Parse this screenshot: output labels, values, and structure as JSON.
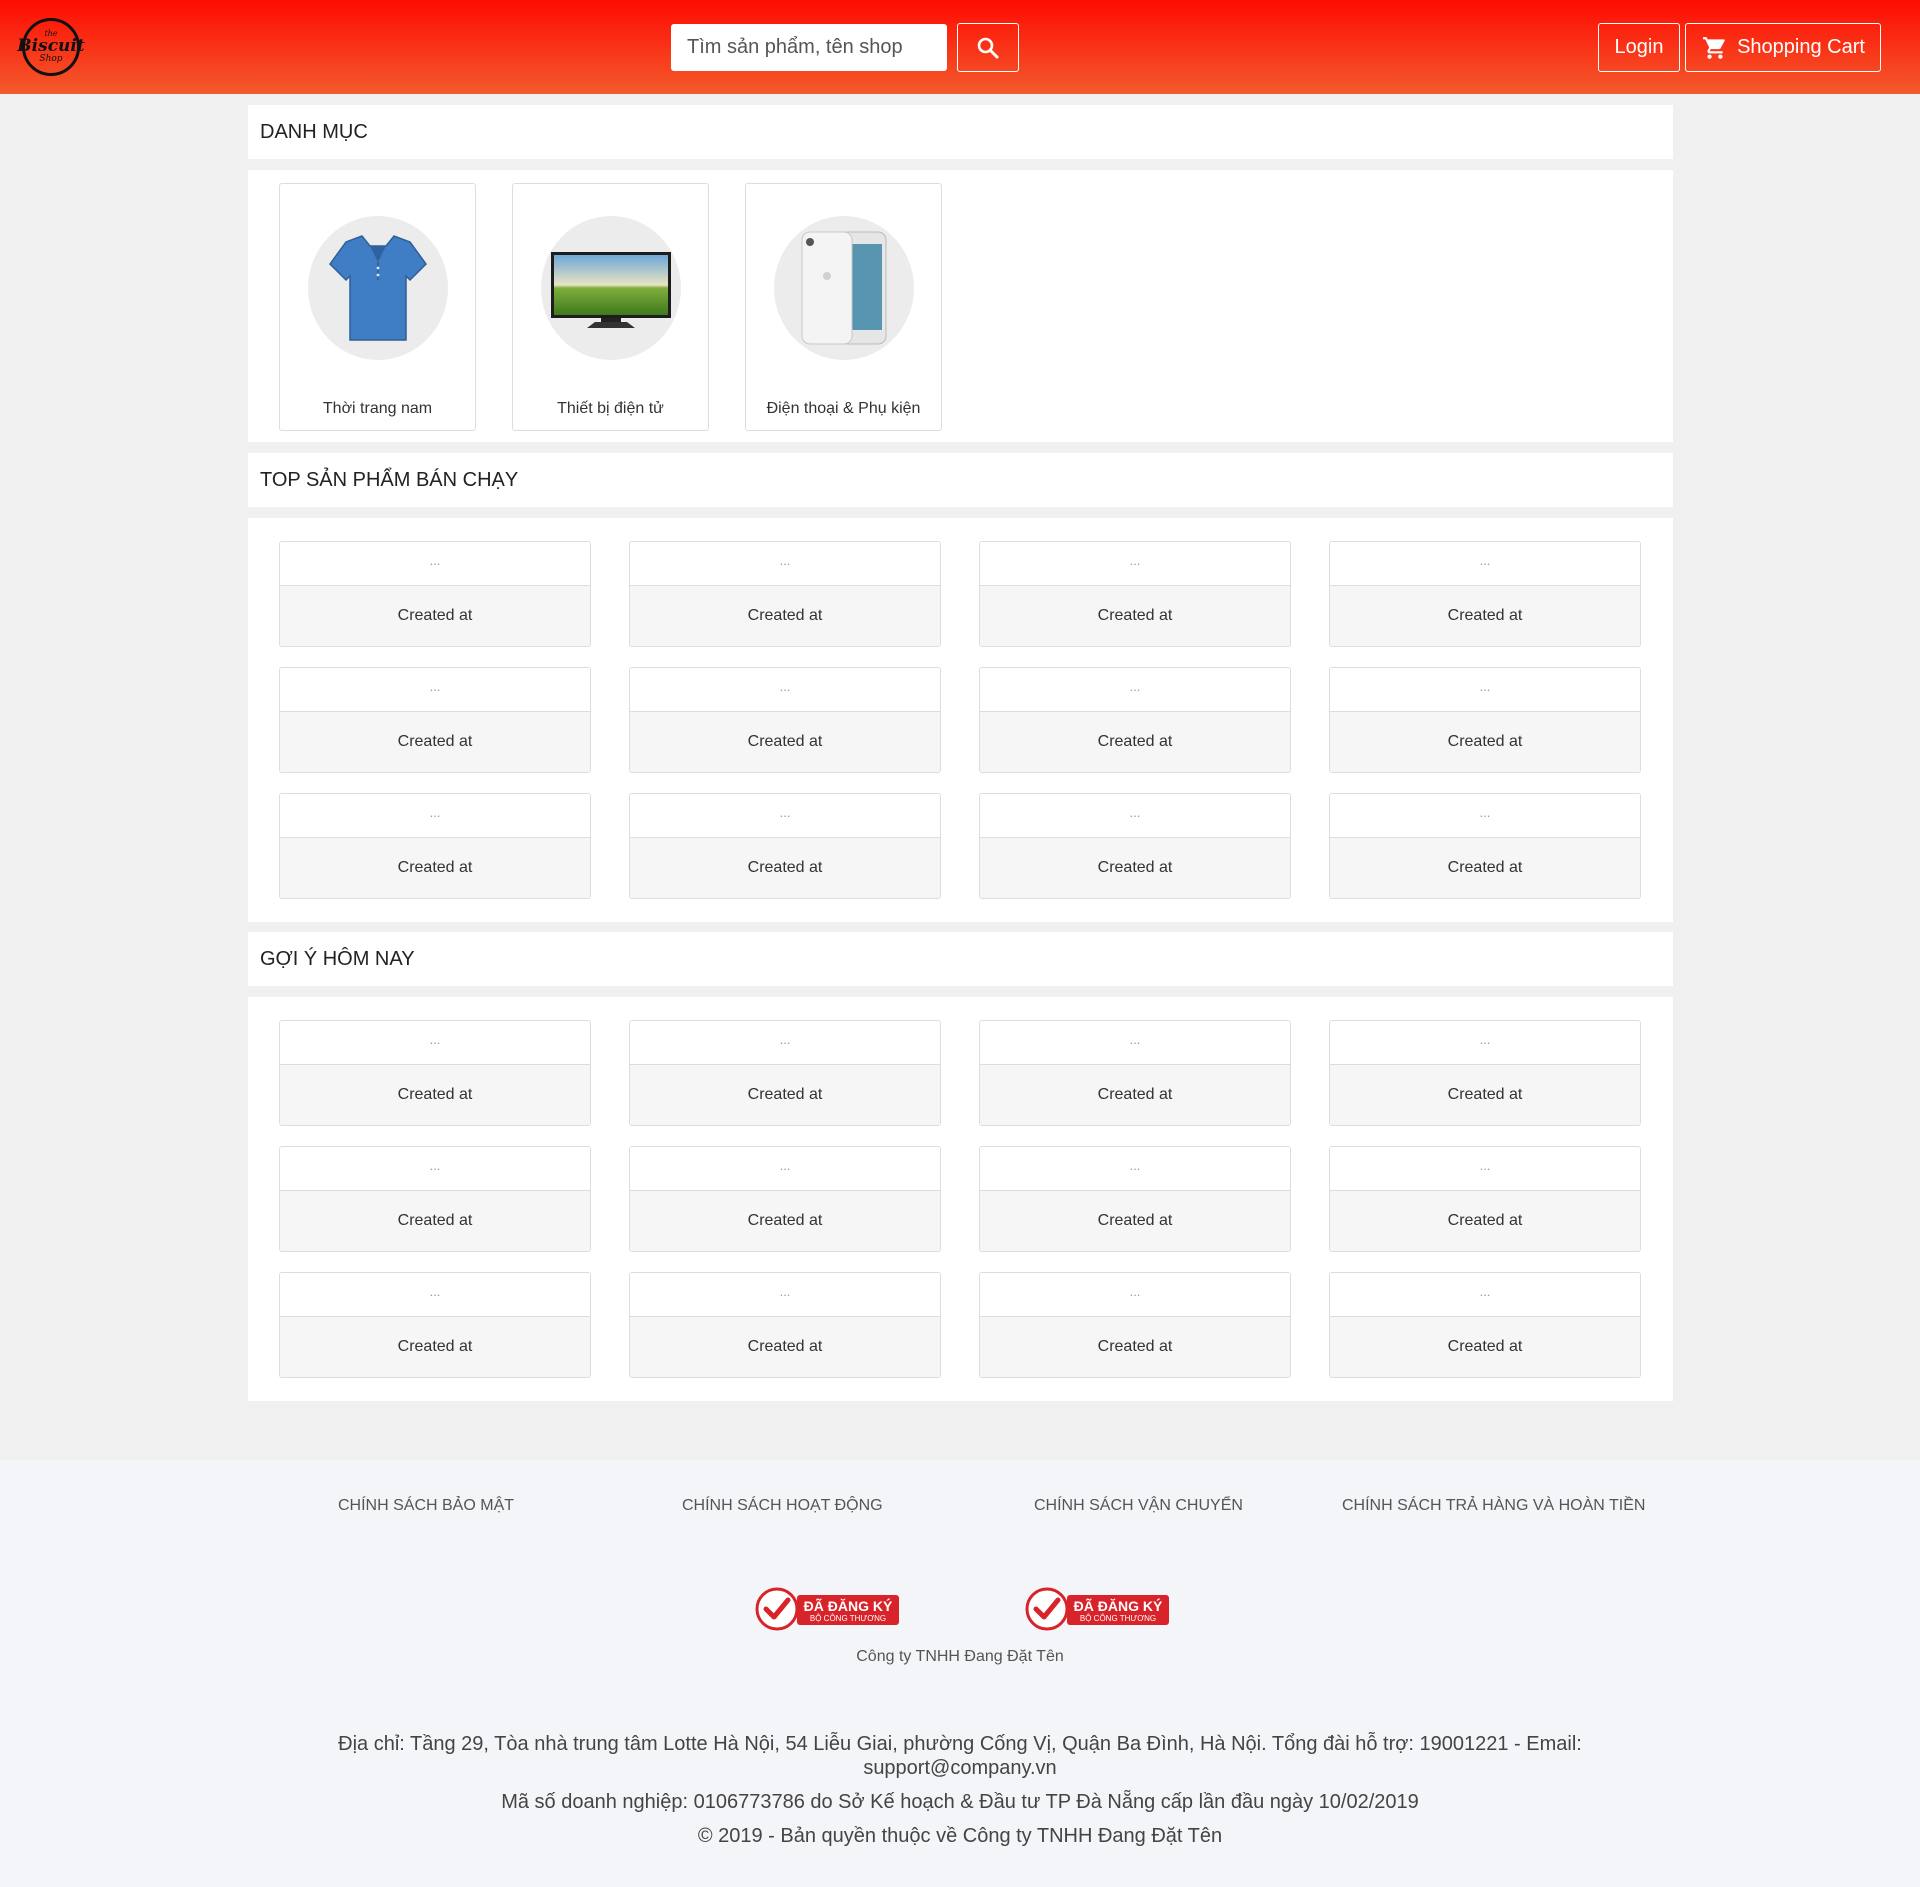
{
  "header": {
    "logo": {
      "line_top": "the",
      "line_main": "Biscuit",
      "line_bottom": "Shop"
    },
    "search_placeholder": "Tìm sản phẩm, tên shop",
    "login_label": "Login",
    "cart_label": "Shopping Cart",
    "colors": {
      "gradient_top": "#ff0b02",
      "gradient_bottom": "#f35a2c"
    }
  },
  "categories": {
    "title": "DANH MỤC",
    "items": [
      {
        "label": "Thời trang nam",
        "icon": "polo-shirt-image"
      },
      {
        "label": "Thiết bị điện tử",
        "icon": "tv-image"
      },
      {
        "label": "Điện thoại & Phụ kiện",
        "icon": "iphone-image"
      }
    ]
  },
  "top_products": {
    "title": "TOP SẢN PHẨM BÁN CHẠY",
    "items": [
      {
        "name": "...",
        "meta": "Created at"
      },
      {
        "name": "...",
        "meta": "Created at"
      },
      {
        "name": "...",
        "meta": "Created at"
      },
      {
        "name": "...",
        "meta": "Created at"
      },
      {
        "name": "...",
        "meta": "Created at"
      },
      {
        "name": "...",
        "meta": "Created at"
      },
      {
        "name": "...",
        "meta": "Created at"
      },
      {
        "name": "...",
        "meta": "Created at"
      },
      {
        "name": "...",
        "meta": "Created at"
      },
      {
        "name": "...",
        "meta": "Created at"
      },
      {
        "name": "...",
        "meta": "Created at"
      },
      {
        "name": "...",
        "meta": "Created at"
      }
    ]
  },
  "suggestions": {
    "title": "GỢI Ý HÔM NAY",
    "items": [
      {
        "name": "...",
        "meta": "Created at"
      },
      {
        "name": "...",
        "meta": "Created at"
      },
      {
        "name": "...",
        "meta": "Created at"
      },
      {
        "name": "...",
        "meta": "Created at"
      },
      {
        "name": "...",
        "meta": "Created at"
      },
      {
        "name": "...",
        "meta": "Created at"
      },
      {
        "name": "...",
        "meta": "Created at"
      },
      {
        "name": "...",
        "meta": "Created at"
      },
      {
        "name": "...",
        "meta": "Created at"
      },
      {
        "name": "...",
        "meta": "Created at"
      },
      {
        "name": "...",
        "meta": "Created at"
      },
      {
        "name": "...",
        "meta": "Created at"
      }
    ]
  },
  "footer": {
    "links": [
      "CHÍNH SÁCH BẢO MẬT",
      "CHÍNH SÁCH HOẠT ĐỘNG",
      "CHÍNH SÁCH VẬN CHUYỂN",
      "CHÍNH SÁCH TRẢ HÀNG VÀ HOÀN TIỀN"
    ],
    "badge": {
      "main": "ĐÃ ĐĂNG KÝ",
      "sub": "BỘ CÔNG THƯƠNG"
    },
    "company_name": "Công ty TNHH Đang Đặt Tên",
    "address": "Địa chỉ: Tầng 29, Tòa nhà trung tâm Lotte Hà Nội, 54 Liễu Giai, phường Cống Vị, Quận Ba Đình, Hà Nội. Tổng đài hỗ trợ: 19001221 - Email: support@company.vn",
    "business_id": "Mã số doanh nghiệp: 0106773786 do Sở Kế hoạch & Đầu tư TP Đà Nẵng cấp lần đầu ngày 10/02/2019",
    "copyright": "© 2019 - Bản quyền thuộc về Công ty TNHH Đang Đặt Tên"
  }
}
